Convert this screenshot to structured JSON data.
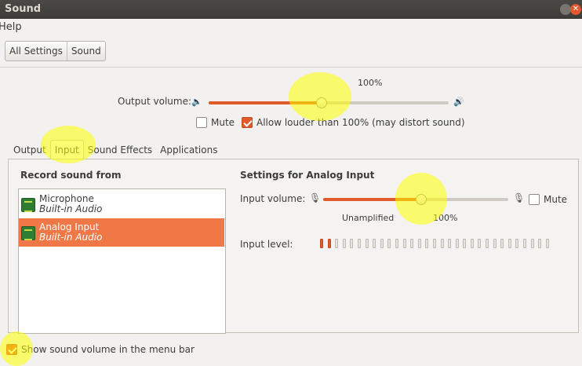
{
  "window": {
    "title": "Sound"
  },
  "menubar": {
    "help": "Help"
  },
  "nav": {
    "all_settings": "All Settings",
    "sound": "Sound"
  },
  "output": {
    "percent_label": "100%",
    "volume_label": "Output volume:",
    "volume_fraction": 0.47,
    "mute_label": "Mute",
    "mute_checked": false,
    "allow_louder_label": "Allow louder than 100% (may distort sound)",
    "allow_louder_checked": true
  },
  "tabs": [
    {
      "label": "Output",
      "active": false
    },
    {
      "label": "Input",
      "active": true
    },
    {
      "label": "Sound Effects",
      "active": false
    },
    {
      "label": "Applications",
      "active": false
    }
  ],
  "input": {
    "record_from_title": "Record sound from",
    "devices": [
      {
        "name": "Microphone",
        "sub": "Built-in Audio",
        "selected": false
      },
      {
        "name": "Analog Input",
        "sub": "Built-in Audio",
        "selected": true
      }
    ],
    "settings_title": "Settings for Analog Input",
    "volume_label": "Input volume:",
    "volume_fraction": 0.53,
    "unamplified_label": "Unamplified",
    "percent_label": "100%",
    "mute_label": "Mute",
    "mute_checked": false,
    "level_label": "Input level:",
    "level_segments_total": 31,
    "level_segments_on": 2
  },
  "footer": {
    "show_volume_label": "Show sound volume in the menu bar",
    "show_volume_checked": true
  },
  "colors": {
    "accent": "#e05b2c",
    "selected_row": "#f07746",
    "highlight": "#ffff00"
  },
  "icons": {
    "speaker_low": "speaker-low-icon",
    "speaker_high": "speaker-high-icon",
    "mic_low": "mic-low-icon",
    "mic_high": "mic-high-icon",
    "device": "sound-card-icon"
  }
}
